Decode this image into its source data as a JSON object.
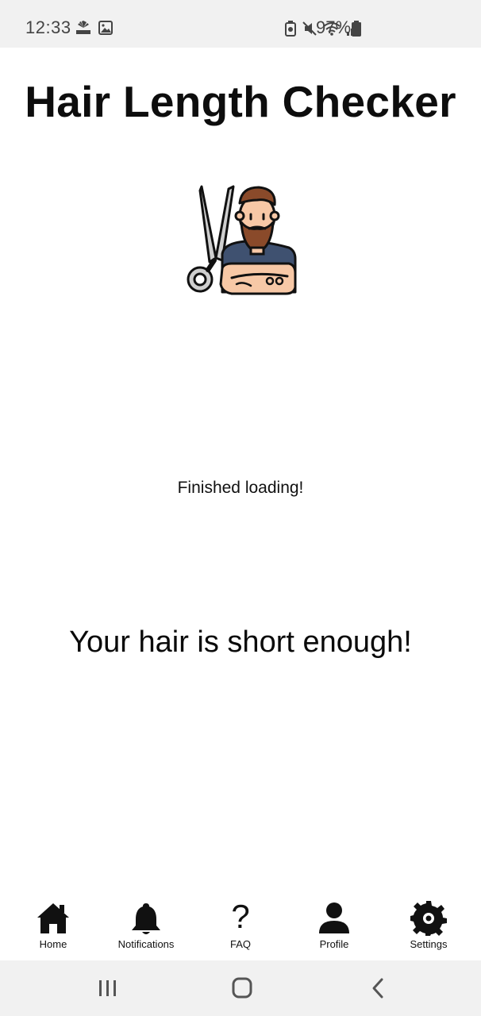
{
  "status_bar": {
    "time": "12:33",
    "battery_percent": "97%",
    "icons": [
      "cnbc-icon",
      "gallery-icon",
      "battery-saver-icon",
      "mute-icon",
      "wifi-icon",
      "signal-icon",
      "battery-icon"
    ]
  },
  "page": {
    "title": "Hair Length Checker",
    "illustration": "barber-scissors-illustration",
    "loading_status": "Finished loading!",
    "result_message": "Your hair is short enough!"
  },
  "bottom_nav": {
    "items": [
      {
        "label": "Home",
        "icon": "home-icon"
      },
      {
        "label": "Notifications",
        "icon": "bell-icon"
      },
      {
        "label": "FAQ",
        "icon": "question-icon",
        "glyph": "?"
      },
      {
        "label": "Profile",
        "icon": "person-icon"
      },
      {
        "label": "Settings",
        "icon": "gear-icon"
      }
    ]
  },
  "system_nav": {
    "buttons": [
      "recent-apps",
      "home",
      "back"
    ]
  },
  "colors": {
    "status_bar_bg": "#f1f1f1",
    "background": "#ffffff",
    "text": "#000000",
    "beard": "#8a4a2a",
    "shirt": "#3f5170",
    "skin": "#f7c8a6"
  }
}
